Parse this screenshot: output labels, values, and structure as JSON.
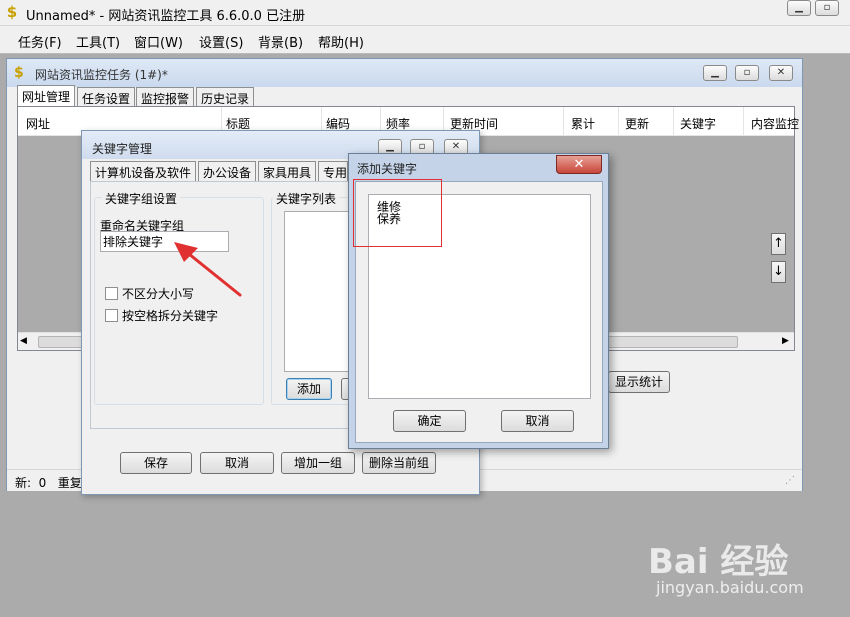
{
  "window": {
    "title": "Unnamed* - 网站资讯监控工具 6.6.0.0  已注册",
    "icon": "dollar-icon"
  },
  "menu": [
    "任务(F)",
    "工具(T)",
    "窗口(W)",
    "设置(S)",
    "背景(B)",
    "帮助(H)"
  ],
  "task_window": {
    "title": "网站资讯监控任务  (1#)*",
    "tabs": [
      "网址管理",
      "任务设置",
      "监控报警",
      "历史记录"
    ],
    "columns": [
      "网址",
      "标题",
      "编码",
      "频率",
      "更新时间",
      "累计",
      "更新",
      "关键字",
      "内容监控"
    ],
    "show_stats": "显示统计",
    "status": "新:  0   重复"
  },
  "kw_dialog": {
    "title": "关键字管理",
    "tabs": [
      "计算机设备及软件",
      "办公设备",
      "家具用具",
      "专用"
    ],
    "group_settings": "关键字组设置",
    "rename_label": "重命名关键字组",
    "rename_value": "排除关键字",
    "case_insensitive": "不区分大小写",
    "split_by_space": "按空格拆分关键字",
    "keyword_list": "关键字列表",
    "add": "添加",
    "save": "保存",
    "cancel": "取消",
    "add_group": "增加一组",
    "delete_group": "删除当前组"
  },
  "add_dialog": {
    "title": "添加关键字",
    "keywords": [
      "维修",
      "保养"
    ],
    "ok": "确定",
    "cancel": "取消"
  },
  "watermark": {
    "logo": "Bai 经验",
    "url": "jingyan.baidu.com"
  },
  "colors": {
    "highlight": "#e03030",
    "arrow": "#e03030",
    "close_button": "#c7453a"
  }
}
